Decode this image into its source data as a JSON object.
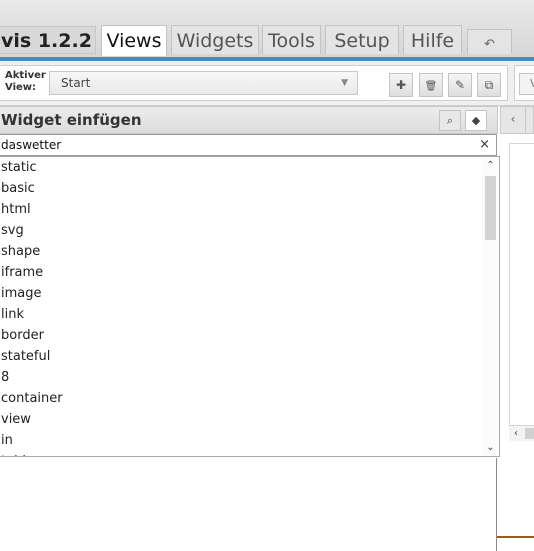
{
  "app": {
    "title": "vis 1.2.2"
  },
  "menu_tabs": [
    {
      "label": "Views",
      "active": true
    },
    {
      "label": "Widgets",
      "active": false
    },
    {
      "label": "Tools",
      "active": false
    },
    {
      "label": "Setup",
      "active": false
    },
    {
      "label": "Hilfe",
      "active": false
    }
  ],
  "undo": {
    "icon": "undo-arrow-icon",
    "glyph": "↶"
  },
  "views_toolbar": {
    "label_line1": "Aktiver",
    "label_line2": "View:",
    "selected_view": "Start",
    "buttons": [
      {
        "icon": "plus-icon",
        "glyph": "✚"
      },
      {
        "icon": "trash-icon",
        "glyph": "🗑"
      },
      {
        "icon": "pencil-icon",
        "glyph": "✎"
      },
      {
        "icon": "copy-icon",
        "glyph": "⧉"
      }
    ],
    "partial_button_text": "V"
  },
  "widget_panel": {
    "title": "Widget einfügen",
    "search_icon_glyph": "⌕",
    "tag_icon_glyph": "◆",
    "filter_value": "daswetter",
    "clear_glyph": "×",
    "items": [
      "static",
      "basic",
      "html",
      "svg",
      "shape",
      "iframe",
      "image",
      "link",
      "border",
      "stateful",
      "8",
      "container",
      "view",
      "in",
      "tables"
    ]
  },
  "nav": {
    "left_glyph": "‹"
  },
  "colors": {
    "accent_line": "#3b8fc9",
    "brown_line": "#9b5a1a"
  }
}
